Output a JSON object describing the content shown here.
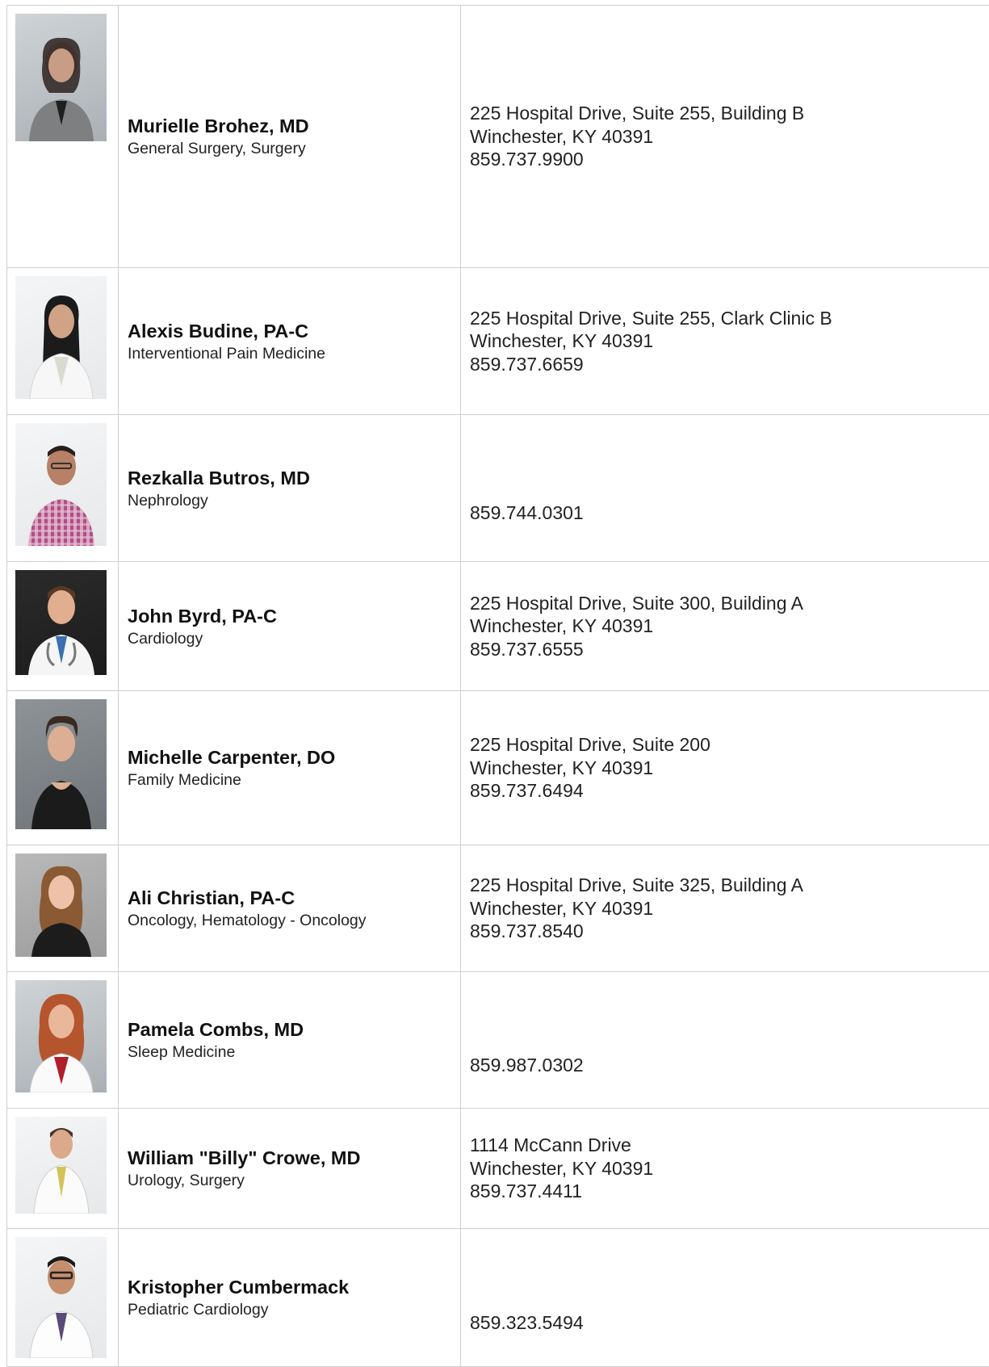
{
  "providers": [
    {
      "name": "Murielle Brohez, MD",
      "specialty": "General Surgery, Surgery",
      "address": "225 Hospital Drive, Suite 255, Building B",
      "city": "Winchester, KY 40391",
      "phone": "859.737.9900",
      "photo_icon": "provider-photo"
    },
    {
      "name": "Alexis Budine, PA-C",
      "specialty": "Interventional Pain Medicine",
      "address": "225 Hospital Drive, Suite 255, Clark Clinic B",
      "city": "Winchester, KY 40391",
      "phone": "859.737.6659",
      "photo_icon": "provider-photo"
    },
    {
      "name": "Rezkalla Butros, MD",
      "specialty": "Nephrology",
      "address": "",
      "city": "",
      "phone": "859.744.0301",
      "photo_icon": "provider-photo"
    },
    {
      "name": "John Byrd, PA-C",
      "specialty": "Cardiology",
      "address": "225 Hospital Drive, Suite 300, Building A",
      "city": "Winchester, KY 40391",
      "phone": "859.737.6555",
      "photo_icon": "provider-photo"
    },
    {
      "name": "Michelle Carpenter, DO",
      "specialty": "Family Medicine",
      "address": "225 Hospital Drive, Suite 200",
      "city": "Winchester, KY 40391",
      "phone": "859.737.6494",
      "photo_icon": "provider-photo"
    },
    {
      "name": "Ali Christian, PA-C",
      "specialty": "Oncology, Hematology - Oncology",
      "address": "225 Hospital Drive, Suite 325, Building A",
      "city": "Winchester, KY 40391",
      "phone": "859.737.8540",
      "photo_icon": "provider-photo"
    },
    {
      "name": "Pamela Combs, MD",
      "specialty": "Sleep Medicine",
      "address": "",
      "city": "",
      "phone": "859.987.0302",
      "photo_icon": "provider-photo"
    },
    {
      "name": "William \"Billy\" Crowe, MD",
      "specialty": "Urology, Surgery",
      "address": "1114 McCann Drive",
      "city": "Winchester, KY 40391",
      "phone": "859.737.4411",
      "photo_icon": "provider-photo"
    },
    {
      "name": "Kristopher Cumbermack",
      "specialty": "Pediatric Cardiology",
      "address": "",
      "city": "",
      "phone": "859.323.5494",
      "photo_icon": "provider-photo"
    }
  ]
}
